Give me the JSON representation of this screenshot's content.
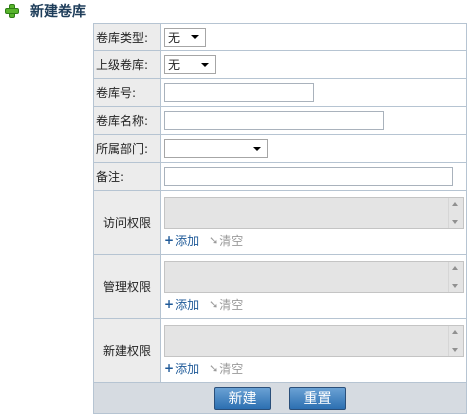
{
  "page": {
    "title": "新建卷库"
  },
  "form": {
    "type": {
      "label": "卷库类型:",
      "value": "无"
    },
    "parent": {
      "label": "上级卷库:",
      "value": "无"
    },
    "number": {
      "label": "卷库号:"
    },
    "name": {
      "label": "卷库名称:"
    },
    "dept": {
      "label": "所属部门:",
      "value": ""
    },
    "note": {
      "label": "备注:"
    },
    "permissions": [
      {
        "label": "访问权限",
        "add": "添加",
        "clear": "清空"
      },
      {
        "label": "管理权限",
        "add": "添加",
        "clear": "清空"
      },
      {
        "label": "新建权限",
        "add": "添加",
        "clear": "清空"
      }
    ]
  },
  "actions": {
    "submit": "新建",
    "reset": "重置"
  },
  "icons": {
    "title": "green-plus-icon",
    "add": "blue-plus-icon",
    "clear": "gray-arrow-icon"
  }
}
